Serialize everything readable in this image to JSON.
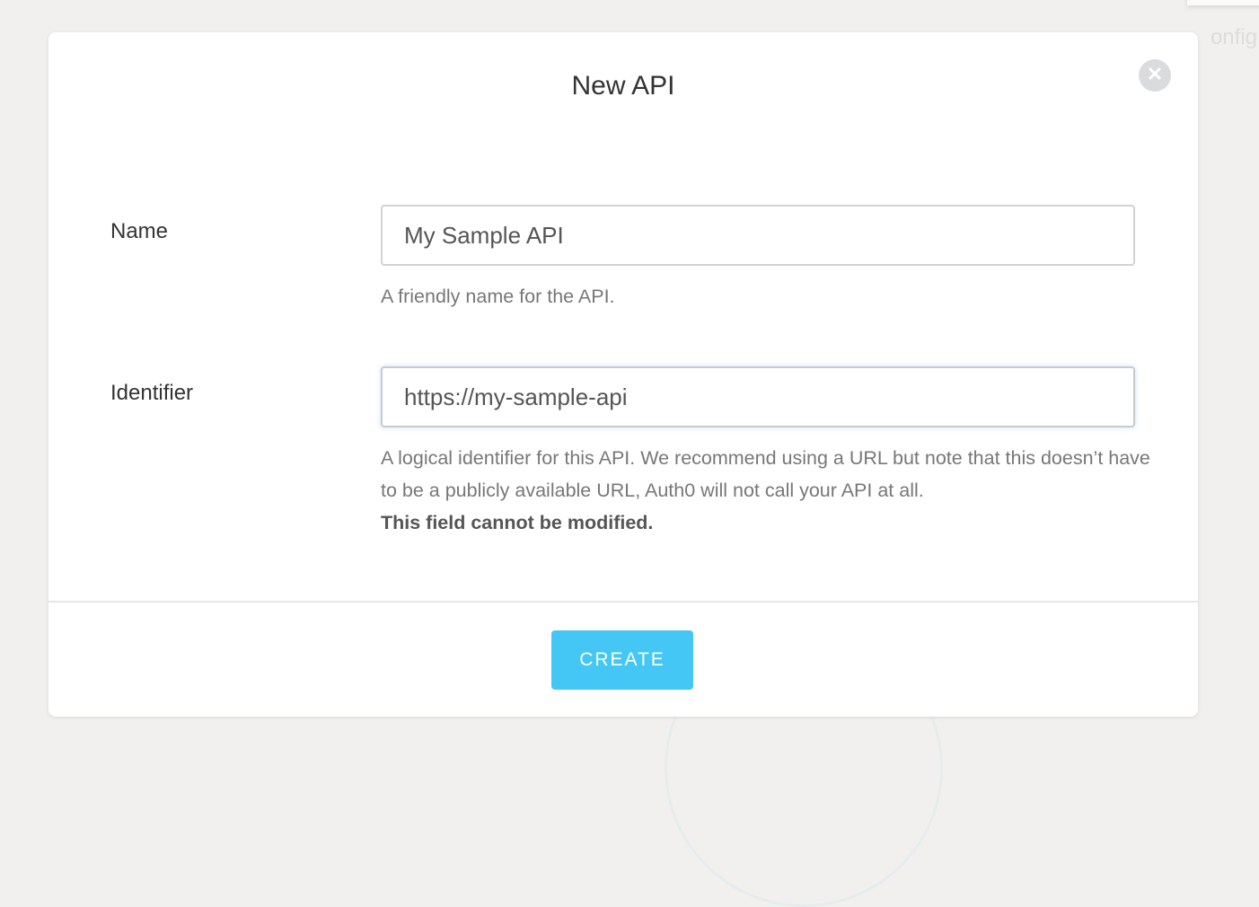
{
  "background": {
    "partial_text": "onfig"
  },
  "modal": {
    "title": "New API",
    "close_icon": "close-icon",
    "fields": {
      "name": {
        "label": "Name",
        "value": "My Sample API",
        "help": "A friendly name for the API."
      },
      "identifier": {
        "label": "Identifier",
        "value": "https://my-sample-api",
        "help": "A logical identifier for this API. We recommend using a URL but note that this doesn’t have to be a publicly available URL, Auth0 will not call your API at all.",
        "help_strong": "This field cannot be modified."
      }
    },
    "create_label": "CREATE"
  },
  "colors": {
    "accent": "#44c7f4",
    "backdrop": "#f1f0ee",
    "close_bg": "#d9dbdd"
  }
}
